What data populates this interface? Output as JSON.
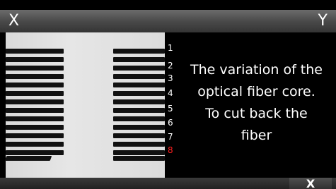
{
  "header": {
    "axis_left": "X",
    "axis_right": "Y"
  },
  "scale": {
    "numbers": [
      "1",
      "2",
      "3",
      "4",
      "5",
      "6",
      "7",
      "8"
    ],
    "active_index": 8,
    "active_color": "#ff2020"
  },
  "message": {
    "lines": [
      "The variation of the",
      "optical fiber core.",
      "To cut back the",
      "fiber"
    ]
  },
  "footer": {
    "close_label": "X"
  }
}
